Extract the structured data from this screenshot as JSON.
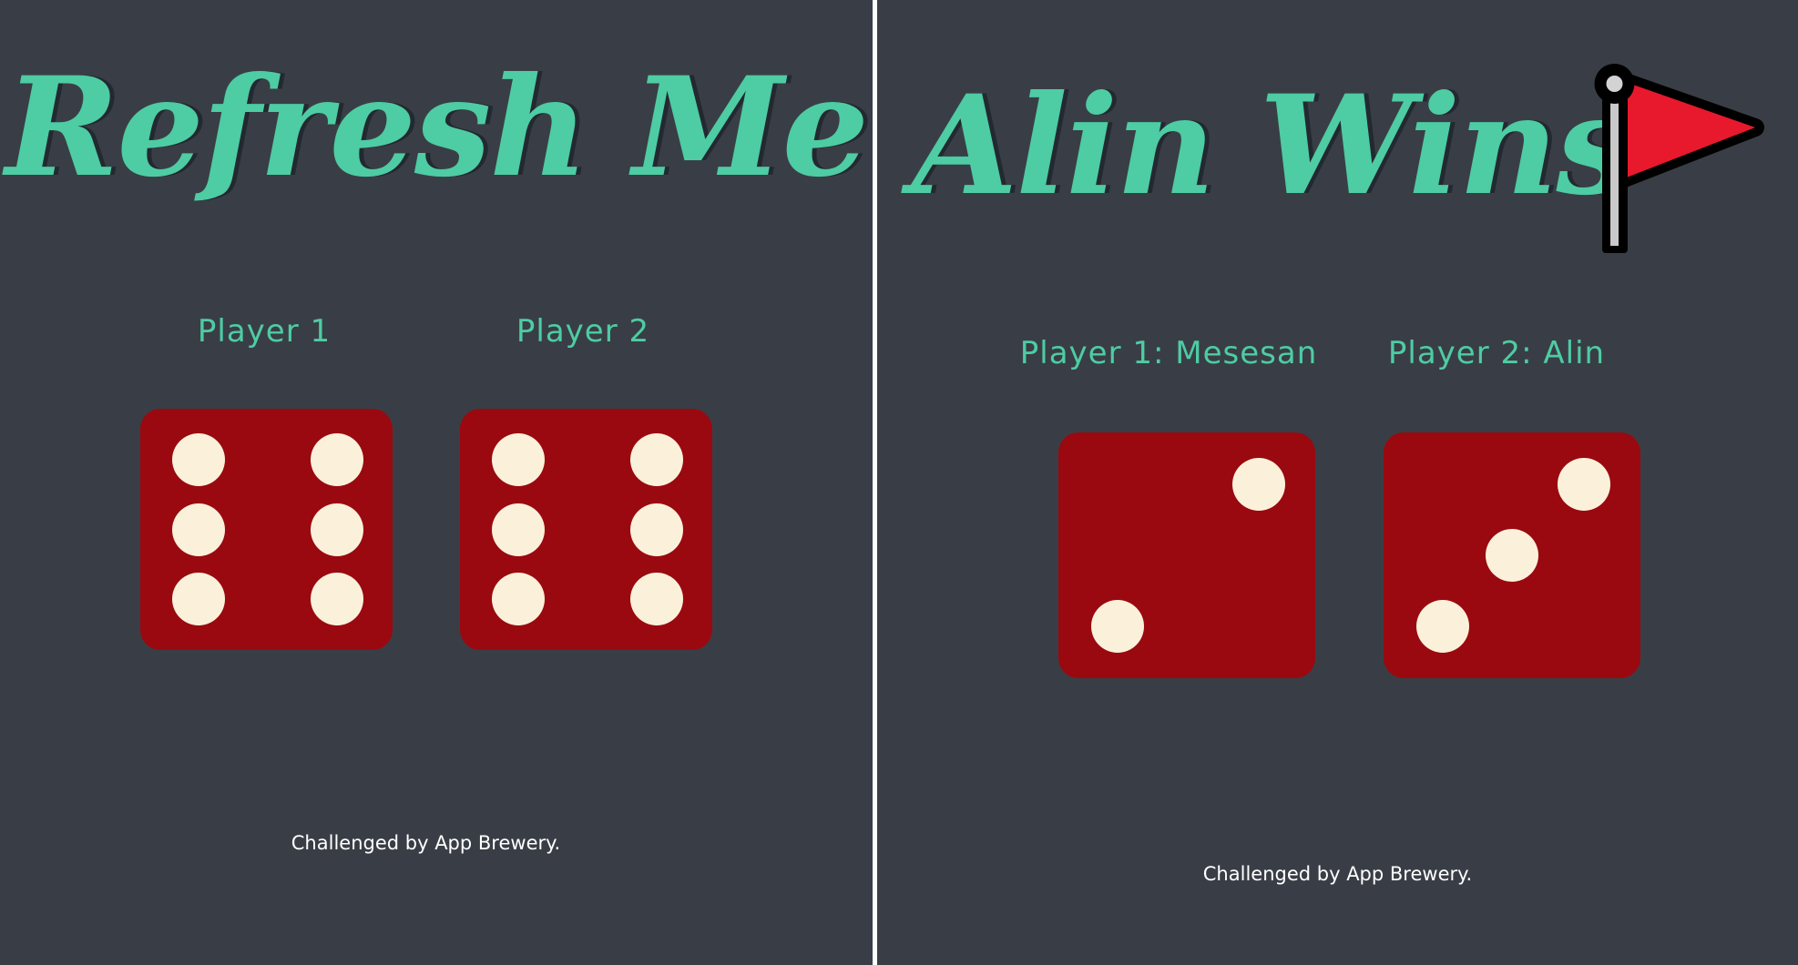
{
  "left_screen": {
    "title": "Refresh Me",
    "players": [
      {
        "label": "Player 1",
        "die_value": 6
      },
      {
        "label": "Player 2",
        "die_value": 6
      }
    ],
    "footer": "Challenged by App Brewery."
  },
  "right_screen": {
    "title": "Alin Wins",
    "title_icon": "red-flag-icon",
    "players": [
      {
        "label": "Player 1: Mesesan",
        "die_value": 2
      },
      {
        "label": "Player 2: Alin",
        "die_value": 3
      }
    ],
    "footer": "Challenged by App Brewery."
  },
  "colors": {
    "background": "#393E46",
    "accent": "#4ECCA3",
    "die": "#9A0910",
    "pip": "#FBF1DA",
    "flag": "#E8192C",
    "footer_text": "#FFFFFF"
  }
}
